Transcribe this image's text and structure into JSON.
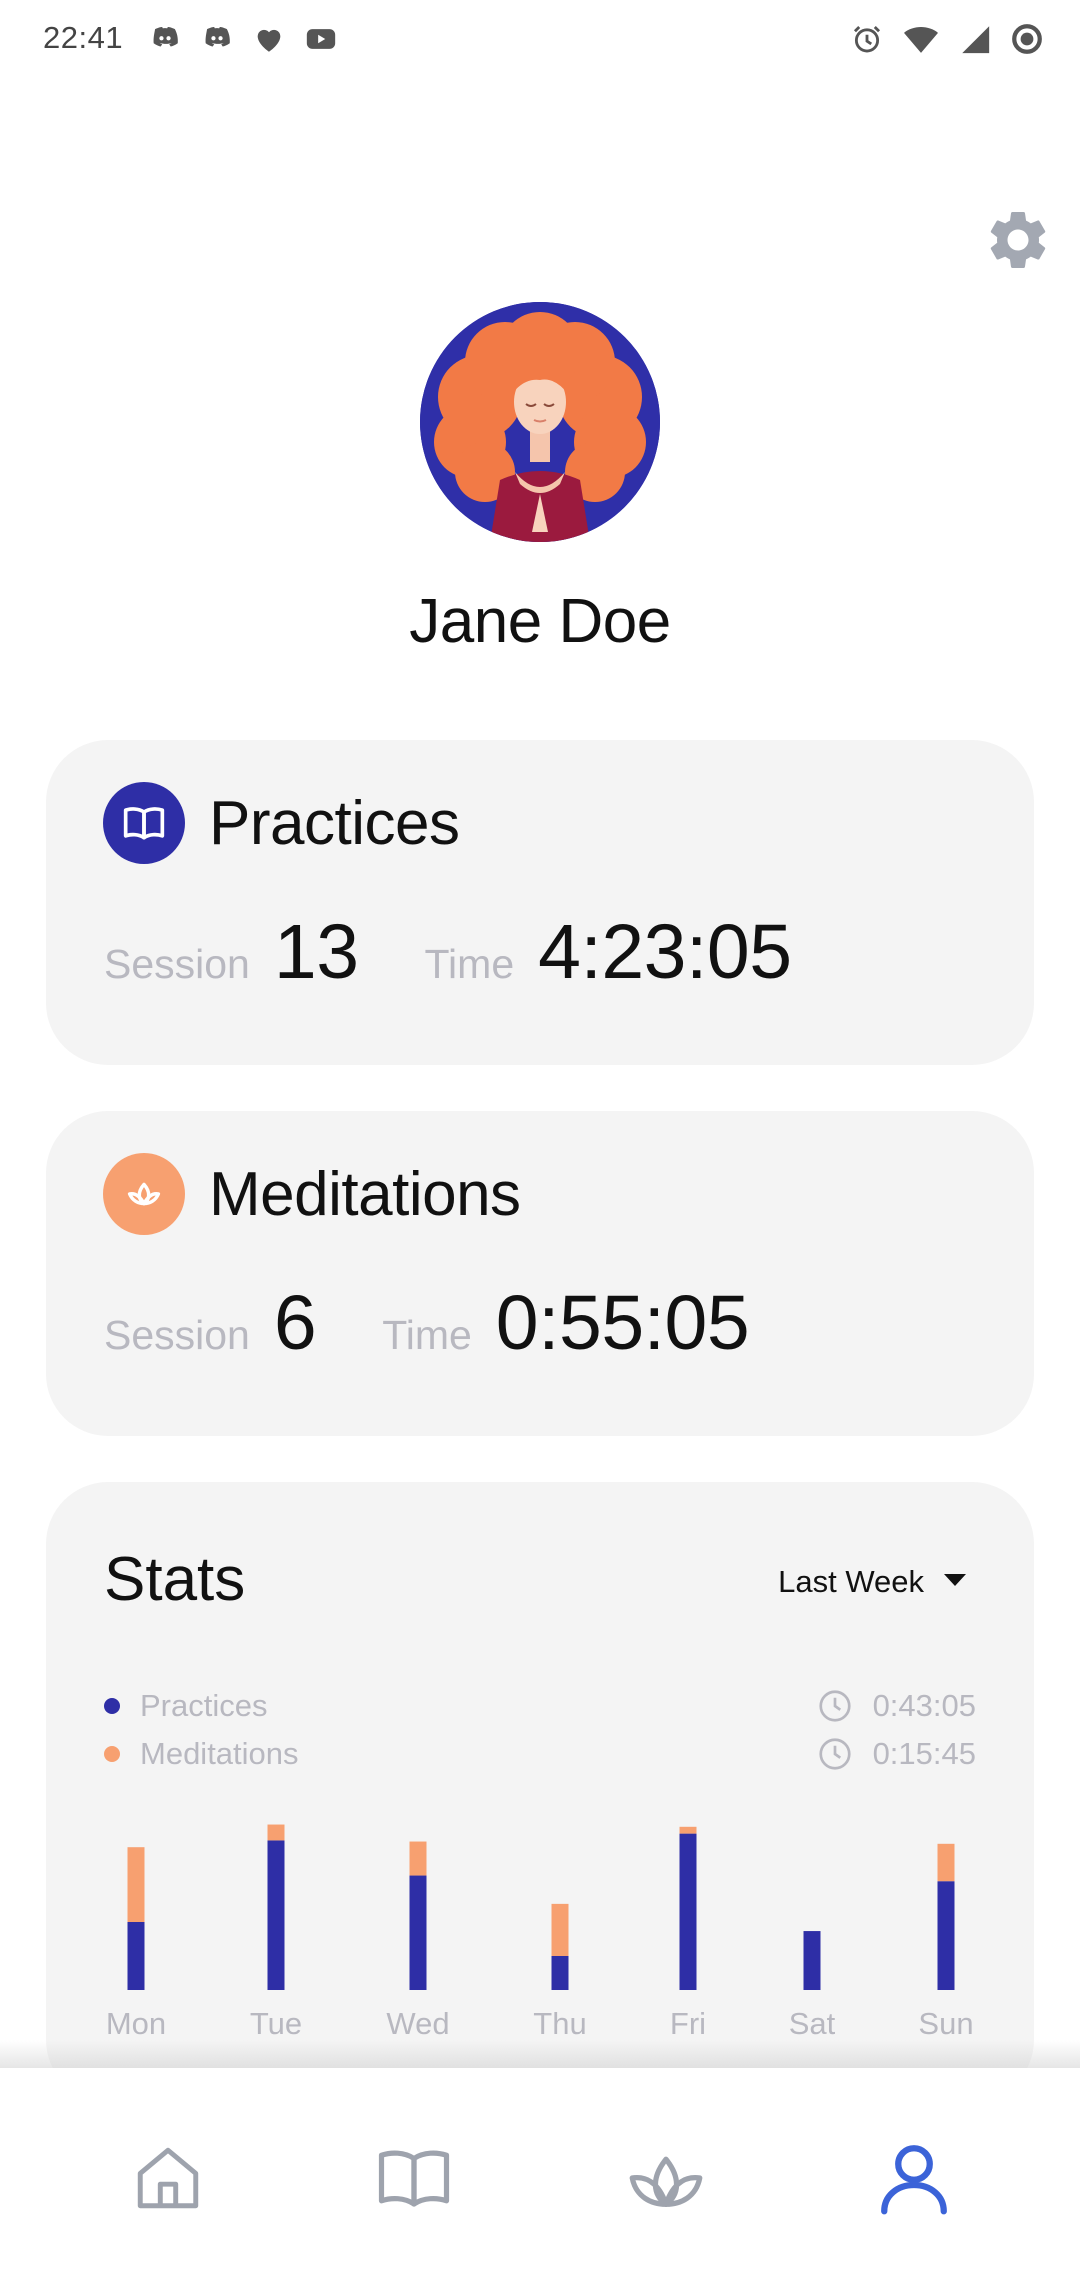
{
  "status_bar": {
    "time": "22:41"
  },
  "profile": {
    "name": "Jane Doe"
  },
  "practices": {
    "title": "Practices",
    "session_label": "Session",
    "session_value": "13",
    "time_label": "Time",
    "time_value": "4:23:05"
  },
  "meditations": {
    "title": "Meditations",
    "session_label": "Session",
    "session_value": "6",
    "time_label": "Time",
    "time_value": "0:55:05"
  },
  "stats": {
    "title": "Stats",
    "range": "Last Week",
    "legend": [
      {
        "label": "Practices",
        "total": "0:43:05",
        "color": "#2e2ea6"
      },
      {
        "label": "Meditations",
        "total": "0:15:45",
        "color": "#f7a070"
      }
    ]
  },
  "chart_data": {
    "type": "bar",
    "stacked": true,
    "categories": [
      "Mon",
      "Tue",
      "Wed",
      "Thu",
      "Fri",
      "Sat",
      "Sun"
    ],
    "series": [
      {
        "name": "Practices",
        "color": "#2e2ea6",
        "values": [
          6.0,
          13.2,
          10.1,
          3.0,
          13.8,
          5.2,
          9.6
        ]
      },
      {
        "name": "Meditations",
        "color": "#f7a070",
        "values": [
          6.6,
          1.4,
          3.0,
          4.6,
          0.6,
          0,
          3.3
        ]
      }
    ],
    "ylim": [
      0,
      15
    ],
    "grid": false,
    "legend": "top-left"
  },
  "colors": {
    "accent_blue": "#2e2ea6",
    "accent_orange": "#f7a070",
    "nav_active": "#3b63d8",
    "nav_inactive": "#9ea3ad"
  },
  "icons": {
    "settings": "gear-icon",
    "practices": "open-book-icon",
    "meditations": "lotus-icon",
    "nav": [
      "home-icon",
      "book-icon",
      "lotus-icon",
      "profile-icon"
    ]
  }
}
